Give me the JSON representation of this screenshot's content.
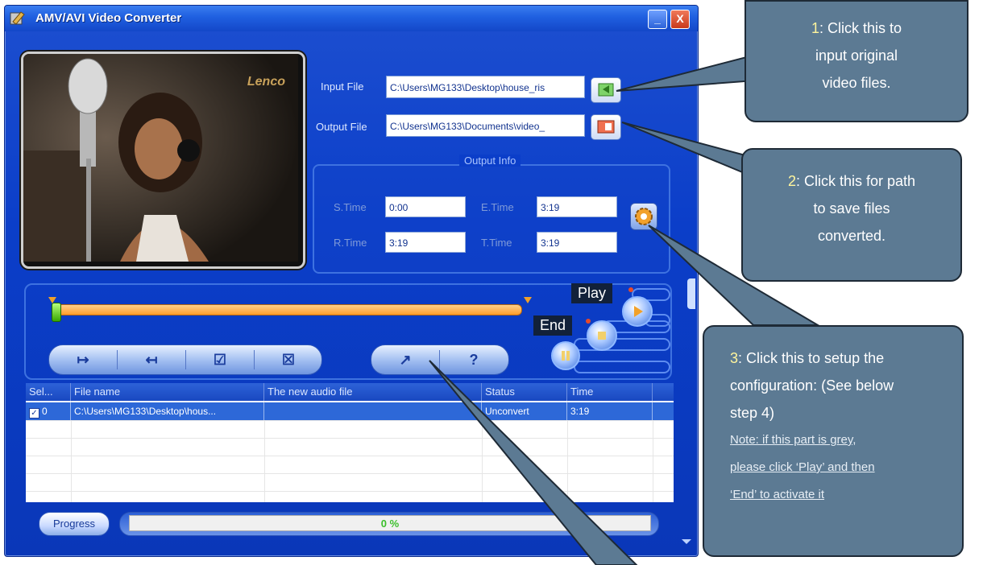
{
  "window": {
    "title": "AMV/AVI Video Converter",
    "minimize_label": "_",
    "close_label": "X"
  },
  "preview": {
    "watermark": "Lenco"
  },
  "files": {
    "input_label": "Input File",
    "input_value": "C:\\Users\\MG133\\Desktop\\house_ris",
    "output_label": "Output File",
    "output_value": "C:\\Users\\MG133\\Documents\\video_"
  },
  "output_info": {
    "title": "Output Info",
    "s_time_label": "S.Time",
    "s_time": "0:00",
    "e_time_label": "E.Time",
    "e_time": "3:19",
    "r_time_label": "R.Time",
    "r_time": "3:19",
    "t_time_label": "T.Time",
    "t_time": "3:19"
  },
  "controls": {
    "set_start": "↦",
    "set_end": "↤",
    "check_all": "☑",
    "delete": "☒",
    "convert": "↗",
    "help": "?"
  },
  "overlay_tags": {
    "play": "Play",
    "end": "End"
  },
  "table": {
    "columns": [
      "Sel...",
      "File name",
      "The new audio file",
      "Status",
      "Time"
    ],
    "rows": [
      {
        "sel": "0",
        "file": "C:\\Users\\MG133\\Desktop\\hous...",
        "new_file": "",
        "status": "Unconvert",
        "time": "3:19"
      }
    ]
  },
  "progress": {
    "button": "Progress",
    "value_text": "0 %",
    "value": 0
  },
  "callouts": {
    "c1": {
      "num": "1",
      "lines": [
        ": Click this to",
        "input original",
        "video files."
      ]
    },
    "c2": {
      "num": "2",
      "lines": [
        ": Click this for path",
        "to save files",
        "converted."
      ]
    },
    "c3": {
      "num": "3",
      "lines": [
        ": Click this to setup the",
        "configuration: (See below",
        "step 4)"
      ],
      "note": [
        "Note: if this part is grey,",
        "please click ‘Play’ and then",
        "‘End’ to activate it"
      ]
    }
  },
  "colors": {
    "callout_bg": "#5c7a93",
    "callout_number": "#fff59d",
    "window_blue": "#0b3ec9"
  }
}
